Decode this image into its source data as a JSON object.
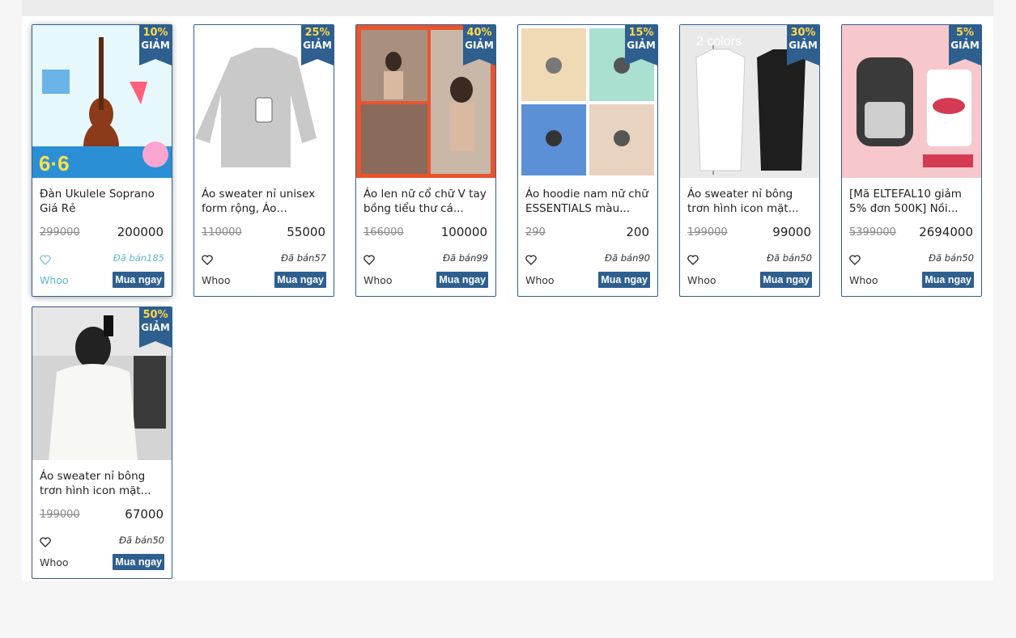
{
  "discount_word": "GIẢM",
  "buy_label": "Mua ngay",
  "sold_prefix": "Đã bán",
  "products": [
    {
      "discount": "10%",
      "title": "Đàn Ukulele Soprano Giá Rẻ",
      "old_price": "299000",
      "price": "200000",
      "sold": "185",
      "shop": "Whoo",
      "thumb_colors": [
        "#5fd0e8",
        "#8b3a1a"
      ]
    },
    {
      "discount": "25%",
      "title": "Áo sweater nỉ unisex form rộng, Áo Hoodie...",
      "old_price": "110000",
      "price": "55000",
      "sold": "57",
      "shop": "Whoo",
      "thumb_colors": [
        "#f4f4f4",
        "#c9c9c9"
      ]
    },
    {
      "discount": "40%",
      "title": "Áo len nữ cổ chữ V tay bồng tiểu thư cá...",
      "old_price": "166000",
      "price": "100000",
      "sold": "99",
      "shop": "Whoo",
      "thumb_colors": [
        "#e8542e",
        "#d9b9a0"
      ]
    },
    {
      "discount": "15%",
      "title": "Áo hoodie nam nữ chữ ESSENTIALS màu...",
      "old_price": "290",
      "price": "200",
      "sold": "90",
      "shop": "Whoo",
      "thumb_colors": [
        "#f0d9b5",
        "#5b8fd6"
      ]
    },
    {
      "discount": "30%",
      "title": "Áo sweater nỉ bông trơn hình icon mặt...",
      "old_price": "199000",
      "price": "99000",
      "sold": "50",
      "shop": "Whoo",
      "thumb_colors": [
        "#e9e9e9",
        "#1e1e1e"
      ]
    },
    {
      "discount": "5%",
      "title": "[Mã ELTEFAL10 giảm 5% đơn 500K] Nồi...",
      "old_price": "5399000",
      "price": "2694000",
      "sold": "50",
      "shop": "Whoo",
      "thumb_colors": [
        "#f6c8cc",
        "#3a3a3a"
      ]
    },
    {
      "discount": "50%",
      "title": "Áo sweater nỉ bông trơn hình icon mặt...",
      "old_price": "199000",
      "price": "67000",
      "sold": "50",
      "shop": "Whoo",
      "thumb_colors": [
        "#d4d4d4",
        "#f7f7f4"
      ]
    }
  ],
  "accent_color": "#2e5f8f",
  "discount_color": "#ffd84a"
}
